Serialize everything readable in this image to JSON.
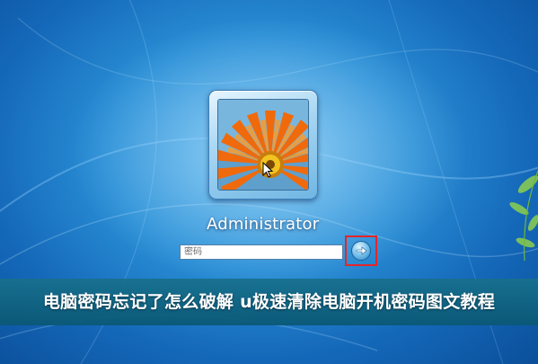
{
  "login": {
    "username": "Administrator",
    "password_placeholder": "密码",
    "user_picture": "orange-gerbera-daisy",
    "submit_icon": "right-arrow-icon",
    "submit_highlight_color": "#e3262a"
  },
  "banner": {
    "title": "电脑密码忘记了怎么破解 u极速清除电脑开机密码图文教程"
  },
  "theme": {
    "background": "#2a8fd6",
    "banner_color": "#0f6a8c"
  }
}
